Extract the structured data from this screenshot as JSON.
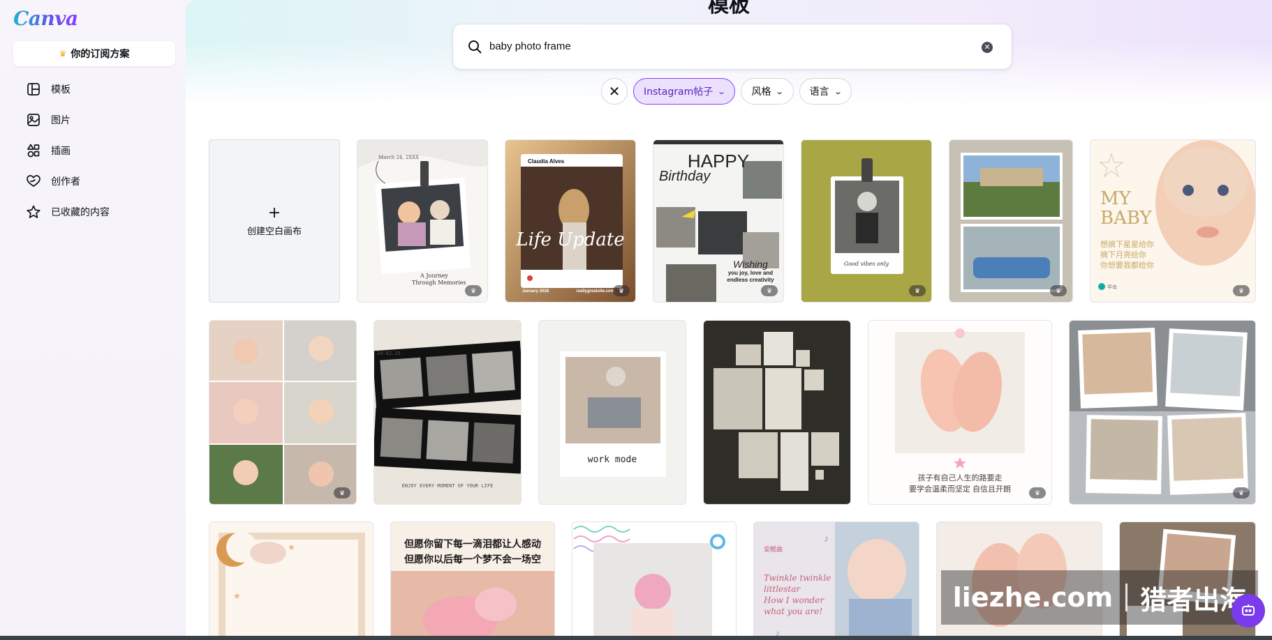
{
  "app": {
    "logo": "Canva"
  },
  "sidebar": {
    "plan_button": "你的订阅方案",
    "items": [
      {
        "label": "模板",
        "icon": "template-icon"
      },
      {
        "label": "图片",
        "icon": "image-icon"
      },
      {
        "label": "插画",
        "icon": "shapes-icon"
      },
      {
        "label": "创作者",
        "icon": "heart-hand-icon"
      },
      {
        "label": "已收藏的内容",
        "icon": "star-icon"
      }
    ]
  },
  "main": {
    "heading": "模板",
    "search": {
      "value": "baby photo frame"
    },
    "filters": [
      {
        "label": "Instagram帖子",
        "active": true
      },
      {
        "label": "风格",
        "active": false
      },
      {
        "label": "语言",
        "active": false
      }
    ],
    "create_blank": "创建空白画布"
  },
  "templates": {
    "t1": {
      "lines": [
        "March 24, 2XXX",
        "A Journey",
        "Through Memories"
      ]
    },
    "t2": {
      "name": "Claudia Alves",
      "script": "Life Update",
      "date": "January 2028",
      "site": "reallygreatsite.com"
    },
    "t3": {
      "lines": [
        "HAPPY",
        "Birthday",
        "Wishing",
        "you joy, love and",
        "endless creativity"
      ]
    },
    "t4": {
      "caption": "Good vibes only"
    },
    "t6": {
      "lines": [
        "MY",
        "BABY",
        "想摘下星星给你",
        "摘下月亮给你",
        "你想要我都给你"
      ],
      "brand": "早岛"
    },
    "t8": {
      "date": "24.02.25",
      "caption": "ENJOY EVERY MOMENT OF YOUR LIFE"
    },
    "t9": {
      "caption": "work mode"
    },
    "t11": {
      "lines": [
        "孩子有自己人生的路要走",
        "要学会温柔而坚定 自信且开朗"
      ]
    },
    "t14": {
      "lines": [
        "但愿你留下每一滴泪都让人感动",
        "但愿你以后每一个梦不会一场空"
      ]
    },
    "t16": {
      "tag": "安眠曲",
      "lines": [
        "Twinkle twinkle",
        "littlestar",
        "How I wonder",
        "what you are!"
      ]
    }
  },
  "watermark": {
    "left": "liezhe.com",
    "right": "猎者出海"
  },
  "colors": {
    "accent": "#8b3dff",
    "chip_active_bg": "#ebe1fc"
  }
}
